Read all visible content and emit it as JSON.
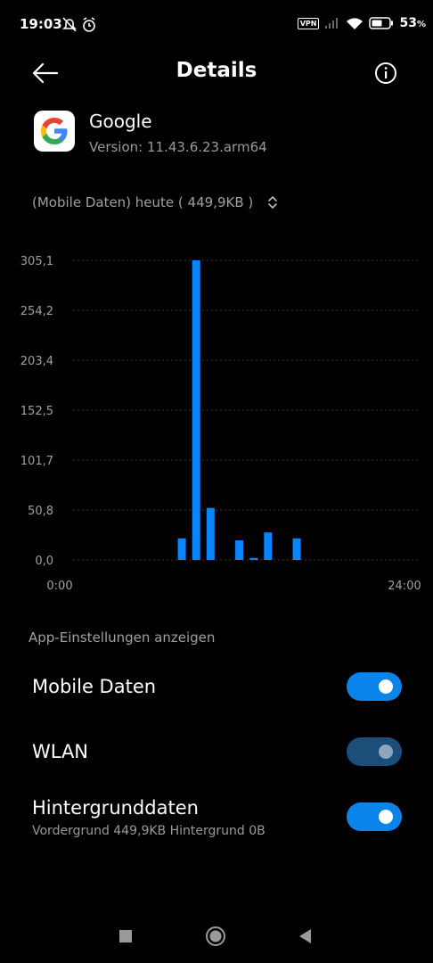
{
  "status_bar": {
    "time": "19:03",
    "vpn_label": "VPN",
    "battery_percent": "53",
    "icons": [
      "notifications-off-icon",
      "alarm-icon",
      "vpn-icon",
      "signal-icon",
      "wifi-icon",
      "battery-icon"
    ]
  },
  "header": {
    "title": "Details",
    "back_icon": "arrow-left-icon",
    "info_icon": "info-icon"
  },
  "app": {
    "name": "Google",
    "version": "Version: 11.43.6.23.arm64",
    "icon": "google-logo"
  },
  "selector": {
    "label": "(Mobile Daten) heute ( 449,9KB )",
    "icon": "up-down-chevron-icon"
  },
  "chart_data": {
    "type": "bar",
    "title": "",
    "xlabel": "",
    "ylabel": "",
    "y_ticks": [
      "305,1",
      "254,2",
      "203,4",
      "152,5",
      "101,7",
      "50,8",
      "0,0"
    ],
    "y_tick_values": [
      305.1,
      254.2,
      203.4,
      152.5,
      101.7,
      50.8,
      0
    ],
    "x_tick_labels": [
      "0:00",
      "24:00"
    ],
    "x_range": [
      0,
      24
    ],
    "ylim": [
      0,
      305.1
    ],
    "grid": true,
    "bar_color": "#0a84ff",
    "x": [
      8.5,
      9.5,
      10.5,
      12.5,
      13.5,
      14.5,
      16.5
    ],
    "values": [
      22,
      305.1,
      53,
      20,
      2,
      28,
      22
    ]
  },
  "settings": {
    "header": "App-Einstellungen anzeigen",
    "rows": [
      {
        "label": "Mobile Daten",
        "state": "on"
      },
      {
        "label": "WLAN",
        "state": "dim"
      },
      {
        "label": "Hintergrunddaten",
        "sublabel": "Vordergrund 449,9KB  Hintergrund 0B",
        "state": "on"
      }
    ]
  },
  "nav_bar": {
    "buttons": [
      "recents-button",
      "home-button",
      "back-button"
    ]
  }
}
